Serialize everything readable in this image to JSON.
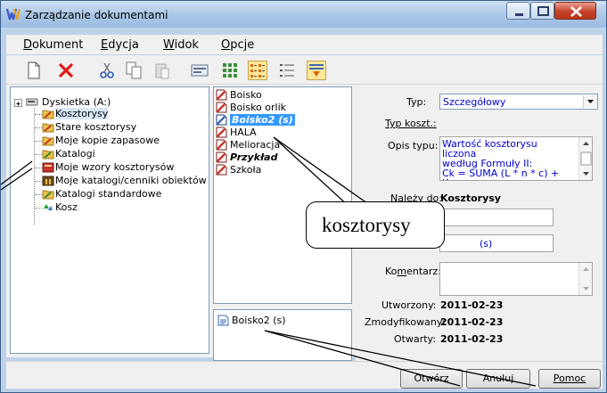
{
  "window": {
    "title": "Zarządzanie dokumentami"
  },
  "menu": [
    {
      "accel": "D",
      "rest": "okument"
    },
    {
      "accel": "E",
      "rest": "dycja"
    },
    {
      "accel": "W",
      "rest": "idok"
    },
    {
      "accel": "O",
      "rest": "pcje"
    }
  ],
  "toolbar": {
    "icons": [
      "new-document-icon",
      "delete-icon",
      "cut-icon",
      "copy-icon",
      "paste-icon",
      "properties-icon",
      "large-icons-view-icon",
      "list-view-icon",
      "details-view-icon",
      "sort-icon"
    ],
    "pressed": [
      "list-view-icon",
      "sort-icon"
    ]
  },
  "tree": {
    "root": "Dyskietka (A:)",
    "items": [
      {
        "label": "Kosztorysy",
        "icon": "folder-kosztorys-icon",
        "selected": true
      },
      {
        "label": "Stare kosztorysy",
        "icon": "folder-kosztorys-icon"
      },
      {
        "label": "Moje kopie zapasowe",
        "icon": "folder-kosztorys-icon"
      },
      {
        "label": "Katalogi",
        "icon": "folder-katalog-icon"
      },
      {
        "label": "Moje wzory kosztorysów",
        "icon": "wzory-icon"
      },
      {
        "label": "Moje katalogi/cenniki obiektów",
        "icon": "cenniki-icon"
      },
      {
        "label": "Katalogi standardowe",
        "icon": "folder-katalog-icon"
      },
      {
        "label": "Kosz",
        "icon": "recycle-icon"
      }
    ]
  },
  "files": [
    {
      "label": "Boisko",
      "style": "normal"
    },
    {
      "label": "Boisko orlik",
      "style": "normal"
    },
    {
      "label": "Boisko2 (s)",
      "style": "selected"
    },
    {
      "label": "HALA",
      "style": "normal"
    },
    {
      "label": "Melioracja",
      "style": "normal"
    },
    {
      "label": "Przykład",
      "style": "bold-italic"
    },
    {
      "label": "Szkoła",
      "style": "normal"
    }
  ],
  "selection": {
    "label": "Boisko2 (s)"
  },
  "properties": {
    "typ_label": "Typ:",
    "typ_value": "Szczegółowy",
    "typ_koszt_label": "Typ koszt.:",
    "opis_label": "Opis typu:",
    "opis_lines": [
      "Wartość kosztorysu liczona",
      "według Formuły II:",
      "Ck = SUMA (L * n * c) + Kp +"
    ],
    "nalezy_label": "Należy do:",
    "nalezy_value": "Kosztorysy",
    "name_field_suffix": "(s)",
    "komentarz_label": "Komentarz:",
    "utworzony_label": "Utworzony:",
    "utworzony_value": "2011-02-23",
    "zmodyfikowany_label": "Zmodyfikowany:",
    "zmodyfikowany_value": "2011-02-23",
    "otwarty_label": "Otwarty:",
    "otwarty_value": "2011-02-23"
  },
  "buttons": {
    "otworz": "Otwórz",
    "anuluj": "Anuluj",
    "pomoc": "Pomoc"
  },
  "callout": {
    "text": "kosztorysy"
  },
  "colors": {
    "selection": "#3399ff",
    "link_text": "#0000cc",
    "pressed": "#ffe79a",
    "close": "#c6432b"
  }
}
